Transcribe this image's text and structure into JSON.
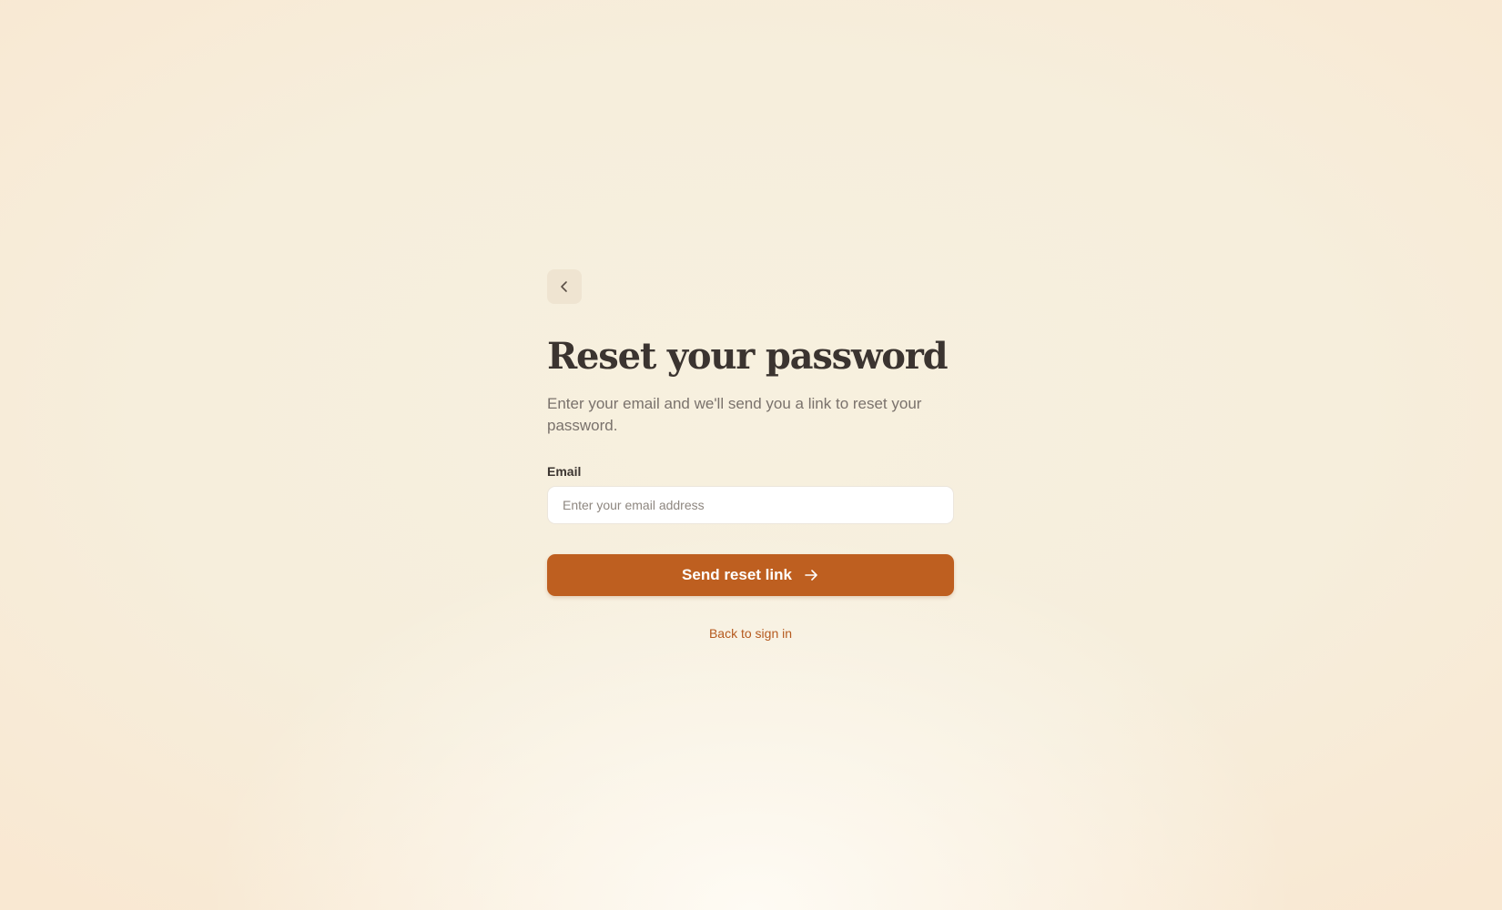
{
  "page": {
    "title": "Reset your password",
    "subtitle": "Enter your email and we'll send you a link to reset your password."
  },
  "form": {
    "email_label": "Email",
    "email_value": "",
    "email_placeholder": "Enter your email address",
    "submit_label": "Send reset link"
  },
  "links": {
    "back_to_sign_in": "Back to sign in"
  },
  "icons": {
    "back": "chevron-left-icon",
    "submit": "arrow-right-icon"
  },
  "colors": {
    "accent": "#be5f20",
    "link": "#b55a1f",
    "heading": "#3b3430",
    "muted": "#7a726c"
  }
}
